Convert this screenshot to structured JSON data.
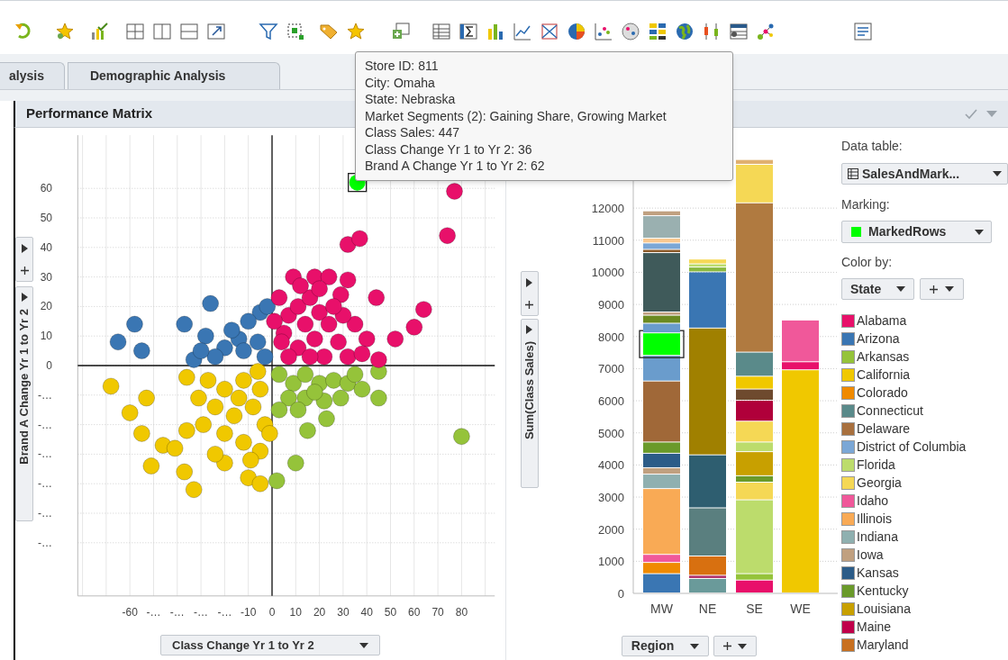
{
  "tabs": [
    {
      "label": "alysis",
      "selected": false
    },
    {
      "label": "Demographic Analysis",
      "selected": false
    }
  ],
  "panel": {
    "title": "Performance Matrix"
  },
  "tooltip": {
    "lines": [
      "Store ID: 811",
      "City: Omaha",
      "State: Nebraska",
      "Market Segments (2): Gaining Share, Growing Market",
      "Class Sales: 447",
      "Class Change Yr 1 to Yr 2: 36",
      "Brand A Change Yr 1 to Yr 2: 62"
    ]
  },
  "scatter": {
    "chart_data": {
      "type": "scatter",
      "xlabel": "Class Change Yr 1 to Yr 2",
      "ylabel": "Brand A Change Yr 1 to Yr 2",
      "xlim": [
        -82,
        94
      ],
      "ylim": [
        -78,
        78
      ],
      "xticks": [
        -60,
        {
          "value": -50,
          "label": "-…"
        },
        {
          "value": -40,
          "label": "-…"
        },
        {
          "value": -30,
          "label": "-…"
        },
        {
          "value": -20,
          "label": "-…"
        },
        -10,
        0,
        10,
        20,
        30,
        40,
        50,
        60,
        70,
        80
      ],
      "yticks": [
        60,
        50,
        40,
        30,
        20,
        10,
        0,
        {
          "value": -10,
          "label": "-…"
        },
        {
          "value": -20,
          "label": "-…"
        },
        {
          "value": -30,
          "label": "-…"
        },
        {
          "value": -40,
          "label": "-…"
        },
        {
          "value": -50,
          "label": "-…"
        },
        {
          "value": -60,
          "label": "-…"
        }
      ],
      "grid": true,
      "series": [
        {
          "color": "#f0c800",
          "x": [
            -68,
            -53,
            -60,
            -55,
            -46,
            -41,
            -51,
            -33,
            -37,
            -20,
            -10,
            -5,
            -27,
            -20,
            -12,
            -5,
            -24,
            -16,
            -8,
            -3,
            -29,
            -20,
            -12,
            -5,
            -24,
            -31,
            -14,
            -6,
            -1,
            -36,
            -9,
            -36
          ],
          "values": [
            -7,
            -11,
            -16,
            -23,
            -27,
            -28,
            -34,
            -42,
            -36,
            -33,
            -38,
            -40,
            -5,
            -8,
            -5,
            -8,
            -14,
            -17,
            -14,
            -20,
            -20,
            -23,
            -26,
            -29,
            -30,
            -11,
            -11,
            -2,
            -23,
            -4,
            -32,
            -22
          ]
        },
        {
          "color": "#95c33a",
          "x": [
            45,
            45,
            80,
            15,
            23,
            10,
            2,
            3,
            9,
            14,
            20,
            26,
            32,
            7,
            14,
            22,
            29,
            35,
            3,
            11,
            18,
            38
          ],
          "values": [
            -2,
            -11,
            -24,
            -22,
            -18,
            -33,
            -39,
            -3,
            -6,
            -3,
            -6,
            -5,
            -6,
            -11,
            -11,
            -12,
            -11,
            -3,
            -15,
            -15,
            -9,
            -8
          ]
        },
        {
          "color": "#3a76b3",
          "x": [
            -65,
            -58,
            -55,
            -37,
            -26,
            -28,
            -20,
            -14,
            -5,
            -2,
            -12,
            -6,
            -24,
            -33,
            -3,
            -10,
            -17,
            -30
          ],
          "values": [
            8,
            14,
            5,
            14,
            21,
            10,
            6,
            9,
            18,
            20,
            5,
            8,
            3,
            2,
            3,
            15,
            12,
            5
          ]
        },
        {
          "color": "#e8106a",
          "x": [
            77,
            74,
            32,
            37,
            18,
            9,
            24,
            32,
            29,
            44,
            64,
            52,
            60,
            40,
            3,
            7,
            11,
            16,
            20,
            14,
            5,
            11,
            18,
            24,
            28,
            22,
            7,
            32,
            35,
            1,
            16,
            30,
            12,
            4,
            26,
            38,
            45,
            20
          ],
          "values": [
            59,
            44,
            41,
            43,
            30,
            30,
            30,
            29,
            24,
            23,
            19,
            9,
            13,
            9,
            23,
            17,
            20,
            23,
            18,
            14,
            11,
            6,
            9,
            14,
            8,
            3,
            3,
            3,
            14,
            15,
            3,
            17,
            27,
            8,
            20,
            4,
            2,
            26
          ]
        },
        {
          "color": "#00ff00",
          "x": [
            36
          ],
          "values": [
            62
          ]
        }
      ]
    }
  },
  "bar_chart": {
    "chart_data": {
      "type": "bar",
      "stacked": true,
      "xlabel": "Region",
      "ylabel": "Sum(Class Sales)",
      "categories": [
        "MW",
        "NE",
        "SE",
        "WE"
      ],
      "ylim": [
        0,
        14500
      ],
      "grid": true,
      "yticks": [
        0,
        1000,
        2000,
        3000,
        4000,
        5000,
        6000,
        7000,
        8000,
        9000,
        10000,
        11000,
        12000
      ],
      "series": [
        {
          "color": "#3a76b3",
          "values": [
            600,
            null,
            null,
            null
          ]
        },
        {
          "color": "#f08a00",
          "values": [
            350,
            null,
            null,
            null
          ]
        },
        {
          "color": "#f0589a",
          "values": [
            250,
            null,
            null,
            null
          ]
        },
        {
          "color": "#f9aa55",
          "values": [
            2050,
            null,
            null,
            null
          ]
        },
        {
          "color": "#8fb0b0",
          "values": [
            450,
            null,
            null,
            null
          ]
        },
        {
          "color": "#c0a080",
          "values": [
            200,
            null,
            null,
            null
          ]
        },
        {
          "color": "#2c5c88",
          "values": [
            450,
            null,
            null,
            null
          ]
        },
        {
          "color": "#6a9a2a",
          "values": [
            350,
            null,
            null,
            null
          ]
        },
        {
          "color": "#a06838",
          "values": [
            1900,
            null,
            null,
            null
          ]
        },
        {
          "color": "#6a9ccc",
          "values": [
            800,
            null,
            null,
            null
          ]
        },
        {
          "color": "#00ff00",
          "values": [
            700,
            null,
            null,
            null
          ]
        },
        {
          "color": "#6a9ccc",
          "values": [
            300,
            null,
            null,
            null
          ]
        },
        {
          "color": "#6b8a20",
          "values": [
            250,
            null,
            null,
            null
          ]
        },
        {
          "color": "#c0a080",
          "values": [
            100,
            null,
            null,
            null
          ]
        },
        {
          "color": "#3f5a5a",
          "values": [
            1850,
            null,
            null,
            null
          ]
        },
        {
          "color": "#8a5a2a",
          "values": [
            100,
            null,
            null,
            null
          ]
        },
        {
          "color": "#7ba7d6",
          "values": [
            200,
            null,
            null,
            null
          ]
        },
        {
          "color": "#f9c890",
          "values": [
            150,
            null,
            null,
            null
          ]
        },
        {
          "color": "#9ab0b0",
          "values": [
            700,
            null,
            null,
            null
          ]
        },
        {
          "color": "#c0a080",
          "values": [
            150,
            null,
            null,
            null
          ]
        },
        {
          "color": "#6a9a9a",
          "values": [
            null,
            450,
            null,
            null
          ]
        },
        {
          "color": "#b0306a",
          "values": [
            null,
            100,
            null,
            null
          ]
        },
        {
          "color": "#d87010",
          "values": [
            null,
            600,
            null,
            null
          ]
        },
        {
          "color": "#5a7f7f",
          "values": [
            null,
            1500,
            null,
            null
          ]
        },
        {
          "color": "#2e5e70",
          "values": [
            null,
            1650,
            null,
            null
          ]
        },
        {
          "color": "#a08000",
          "values": [
            null,
            3950,
            null,
            null
          ]
        },
        {
          "color": "#3a76b3",
          "values": [
            null,
            1750,
            null,
            null
          ]
        },
        {
          "color": "#8ab840",
          "values": [
            null,
            150,
            null,
            null
          ]
        },
        {
          "color": "#bcdc6c",
          "values": [
            null,
            100,
            null,
            null
          ]
        },
        {
          "color": "#f5d855",
          "values": [
            null,
            150,
            null,
            null
          ]
        },
        {
          "color": "#e8106a",
          "values": [
            null,
            null,
            400,
            null
          ]
        },
        {
          "color": "#95c33a",
          "values": [
            null,
            null,
            200,
            null
          ]
        },
        {
          "color": "#bcdc6c",
          "values": [
            null,
            null,
            2300,
            null
          ]
        },
        {
          "color": "#f5d855",
          "values": [
            null,
            null,
            550,
            null
          ]
        },
        {
          "color": "#6a9a2a",
          "values": [
            null,
            null,
            200,
            null
          ]
        },
        {
          "color": "#c8a000",
          "values": [
            null,
            null,
            750,
            null
          ]
        },
        {
          "color": "#bcdc6c",
          "values": [
            null,
            null,
            300,
            null
          ]
        },
        {
          "color": "#f5d855",
          "values": [
            null,
            null,
            650,
            null
          ]
        },
        {
          "color": "#b0003a",
          "values": [
            null,
            null,
            650,
            null
          ]
        },
        {
          "color": "#6e4a2e",
          "values": [
            null,
            null,
            350,
            null
          ]
        },
        {
          "color": "#f0c800",
          "values": [
            null,
            null,
            400,
            null
          ]
        },
        {
          "color": "#5a8a8a",
          "values": [
            null,
            null,
            750,
            null
          ]
        },
        {
          "color": "#b07a40",
          "values": [
            null,
            null,
            4650,
            null
          ]
        },
        {
          "color": "#f5d855",
          "values": [
            null,
            null,
            1200,
            null
          ]
        },
        {
          "color": "#e0b070",
          "values": [
            null,
            null,
            150,
            null
          ]
        },
        {
          "color": "#f0c800",
          "values": [
            null,
            null,
            null,
            6950
          ]
        },
        {
          "color": "#e8106a",
          "values": [
            null,
            null,
            null,
            250
          ]
        },
        {
          "color": "#f0589a",
          "values": [
            null,
            null,
            null,
            1300
          ]
        }
      ]
    }
  },
  "legend_panel": {
    "data_table_label": "Data table:",
    "data_table": "SalesAndMark...",
    "marking_label": "Marking:",
    "marking": {
      "label": "MarkedRows",
      "color": "#00ff00"
    },
    "color_by_label": "Color by:",
    "color_by": "State",
    "items": [
      {
        "label": "Alabama",
        "color": "#e8106a"
      },
      {
        "label": "Arizona",
        "color": "#3a76b3"
      },
      {
        "label": "Arkansas",
        "color": "#95c33a"
      },
      {
        "label": "California",
        "color": "#f0c800"
      },
      {
        "label": "Colorado",
        "color": "#f08a00"
      },
      {
        "label": "Connecticut",
        "color": "#5a8a8a"
      },
      {
        "label": "Delaware",
        "color": "#a8703e"
      },
      {
        "label": "District of Columbia",
        "color": "#7ba7d6"
      },
      {
        "label": "Florida",
        "color": "#bcdc6c"
      },
      {
        "label": "Georgia",
        "color": "#f5d855"
      },
      {
        "label": "Idaho",
        "color": "#f0589a"
      },
      {
        "label": "Illinois",
        "color": "#f9aa55"
      },
      {
        "label": "Indiana",
        "color": "#8fb0b0"
      },
      {
        "label": "Iowa",
        "color": "#c0a080"
      },
      {
        "label": "Kansas",
        "color": "#2c5c88"
      },
      {
        "label": "Kentucky",
        "color": "#6a9a2a"
      },
      {
        "label": "Louisiana",
        "color": "#c8a000"
      },
      {
        "label": "Maine",
        "color": "#c0004a"
      },
      {
        "label": "Maryland",
        "color": "#c87020"
      }
    ]
  }
}
